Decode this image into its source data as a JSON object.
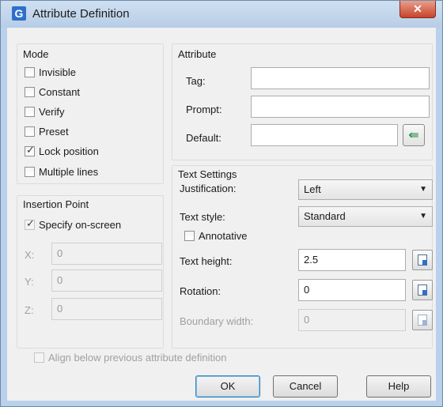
{
  "window": {
    "title": "Attribute Definition",
    "close_symbol": "✕",
    "icon_letter": "G"
  },
  "mode": {
    "title": "Mode",
    "items": [
      {
        "label": "Invisible",
        "checked": false
      },
      {
        "label": "Constant",
        "checked": false
      },
      {
        "label": "Verify",
        "checked": false
      },
      {
        "label": "Preset",
        "checked": false
      },
      {
        "label": "Lock position",
        "checked": true
      },
      {
        "label": "Multiple lines",
        "checked": false
      }
    ]
  },
  "insertion": {
    "title": "Insertion Point",
    "specify_label": "Specify on-screen",
    "specify_checked": true,
    "x_label": "X:",
    "x_value": "0",
    "y_label": "Y:",
    "y_value": "0",
    "z_label": "Z:",
    "z_value": "0"
  },
  "attribute": {
    "title": "Attribute",
    "tag_label": "Tag:",
    "tag_value": "",
    "prompt_label": "Prompt:",
    "prompt_value": "",
    "default_label": "Default:",
    "default_value": ""
  },
  "text_settings": {
    "title": "Text Settings",
    "justification_label": "Justification:",
    "justification_value": "Left",
    "style_label": "Text style:",
    "style_value": "Standard",
    "annotative_label": "Annotative",
    "annotative_checked": false,
    "height_label": "Text height:",
    "height_value": "2.5",
    "rotation_label": "Rotation:",
    "rotation_value": "0",
    "boundary_label": "Boundary width:",
    "boundary_value": "0"
  },
  "align_label": "Align below previous attribute definition",
  "buttons": {
    "ok": "OK",
    "cancel": "Cancel",
    "help": "Help"
  },
  "colors": {
    "title_bar": "#b9d1ea",
    "close_button": "#c7432b",
    "dialog_bg": "#f0f0f0"
  }
}
